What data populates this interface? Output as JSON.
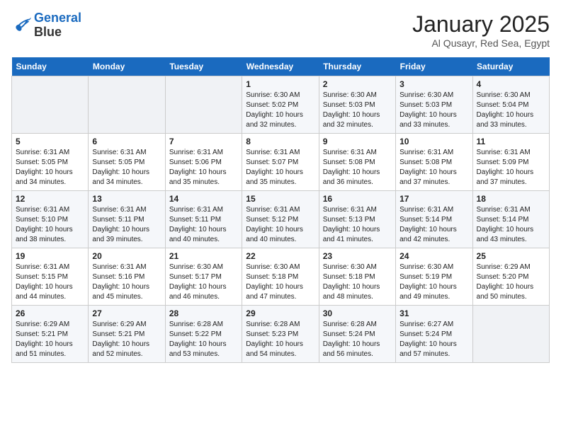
{
  "header": {
    "logo_line1": "General",
    "logo_line2": "Blue",
    "title": "January 2025",
    "subtitle": "Al Qusayr, Red Sea, Egypt"
  },
  "weekdays": [
    "Sunday",
    "Monday",
    "Tuesday",
    "Wednesday",
    "Thursday",
    "Friday",
    "Saturday"
  ],
  "weeks": [
    [
      {
        "day": "",
        "info": ""
      },
      {
        "day": "",
        "info": ""
      },
      {
        "day": "",
        "info": ""
      },
      {
        "day": "1",
        "info": "Sunrise: 6:30 AM\nSunset: 5:02 PM\nDaylight: 10 hours\nand 32 minutes."
      },
      {
        "day": "2",
        "info": "Sunrise: 6:30 AM\nSunset: 5:03 PM\nDaylight: 10 hours\nand 32 minutes."
      },
      {
        "day": "3",
        "info": "Sunrise: 6:30 AM\nSunset: 5:03 PM\nDaylight: 10 hours\nand 33 minutes."
      },
      {
        "day": "4",
        "info": "Sunrise: 6:30 AM\nSunset: 5:04 PM\nDaylight: 10 hours\nand 33 minutes."
      }
    ],
    [
      {
        "day": "5",
        "info": "Sunrise: 6:31 AM\nSunset: 5:05 PM\nDaylight: 10 hours\nand 34 minutes."
      },
      {
        "day": "6",
        "info": "Sunrise: 6:31 AM\nSunset: 5:05 PM\nDaylight: 10 hours\nand 34 minutes."
      },
      {
        "day": "7",
        "info": "Sunrise: 6:31 AM\nSunset: 5:06 PM\nDaylight: 10 hours\nand 35 minutes."
      },
      {
        "day": "8",
        "info": "Sunrise: 6:31 AM\nSunset: 5:07 PM\nDaylight: 10 hours\nand 35 minutes."
      },
      {
        "day": "9",
        "info": "Sunrise: 6:31 AM\nSunset: 5:08 PM\nDaylight: 10 hours\nand 36 minutes."
      },
      {
        "day": "10",
        "info": "Sunrise: 6:31 AM\nSunset: 5:08 PM\nDaylight: 10 hours\nand 37 minutes."
      },
      {
        "day": "11",
        "info": "Sunrise: 6:31 AM\nSunset: 5:09 PM\nDaylight: 10 hours\nand 37 minutes."
      }
    ],
    [
      {
        "day": "12",
        "info": "Sunrise: 6:31 AM\nSunset: 5:10 PM\nDaylight: 10 hours\nand 38 minutes."
      },
      {
        "day": "13",
        "info": "Sunrise: 6:31 AM\nSunset: 5:11 PM\nDaylight: 10 hours\nand 39 minutes."
      },
      {
        "day": "14",
        "info": "Sunrise: 6:31 AM\nSunset: 5:11 PM\nDaylight: 10 hours\nand 40 minutes."
      },
      {
        "day": "15",
        "info": "Sunrise: 6:31 AM\nSunset: 5:12 PM\nDaylight: 10 hours\nand 40 minutes."
      },
      {
        "day": "16",
        "info": "Sunrise: 6:31 AM\nSunset: 5:13 PM\nDaylight: 10 hours\nand 41 minutes."
      },
      {
        "day": "17",
        "info": "Sunrise: 6:31 AM\nSunset: 5:14 PM\nDaylight: 10 hours\nand 42 minutes."
      },
      {
        "day": "18",
        "info": "Sunrise: 6:31 AM\nSunset: 5:14 PM\nDaylight: 10 hours\nand 43 minutes."
      }
    ],
    [
      {
        "day": "19",
        "info": "Sunrise: 6:31 AM\nSunset: 5:15 PM\nDaylight: 10 hours\nand 44 minutes."
      },
      {
        "day": "20",
        "info": "Sunrise: 6:31 AM\nSunset: 5:16 PM\nDaylight: 10 hours\nand 45 minutes."
      },
      {
        "day": "21",
        "info": "Sunrise: 6:30 AM\nSunset: 5:17 PM\nDaylight: 10 hours\nand 46 minutes."
      },
      {
        "day": "22",
        "info": "Sunrise: 6:30 AM\nSunset: 5:18 PM\nDaylight: 10 hours\nand 47 minutes."
      },
      {
        "day": "23",
        "info": "Sunrise: 6:30 AM\nSunset: 5:18 PM\nDaylight: 10 hours\nand 48 minutes."
      },
      {
        "day": "24",
        "info": "Sunrise: 6:30 AM\nSunset: 5:19 PM\nDaylight: 10 hours\nand 49 minutes."
      },
      {
        "day": "25",
        "info": "Sunrise: 6:29 AM\nSunset: 5:20 PM\nDaylight: 10 hours\nand 50 minutes."
      }
    ],
    [
      {
        "day": "26",
        "info": "Sunrise: 6:29 AM\nSunset: 5:21 PM\nDaylight: 10 hours\nand 51 minutes."
      },
      {
        "day": "27",
        "info": "Sunrise: 6:29 AM\nSunset: 5:21 PM\nDaylight: 10 hours\nand 52 minutes."
      },
      {
        "day": "28",
        "info": "Sunrise: 6:28 AM\nSunset: 5:22 PM\nDaylight: 10 hours\nand 53 minutes."
      },
      {
        "day": "29",
        "info": "Sunrise: 6:28 AM\nSunset: 5:23 PM\nDaylight: 10 hours\nand 54 minutes."
      },
      {
        "day": "30",
        "info": "Sunrise: 6:28 AM\nSunset: 5:24 PM\nDaylight: 10 hours\nand 56 minutes."
      },
      {
        "day": "31",
        "info": "Sunrise: 6:27 AM\nSunset: 5:24 PM\nDaylight: 10 hours\nand 57 minutes."
      },
      {
        "day": "",
        "info": ""
      }
    ]
  ]
}
